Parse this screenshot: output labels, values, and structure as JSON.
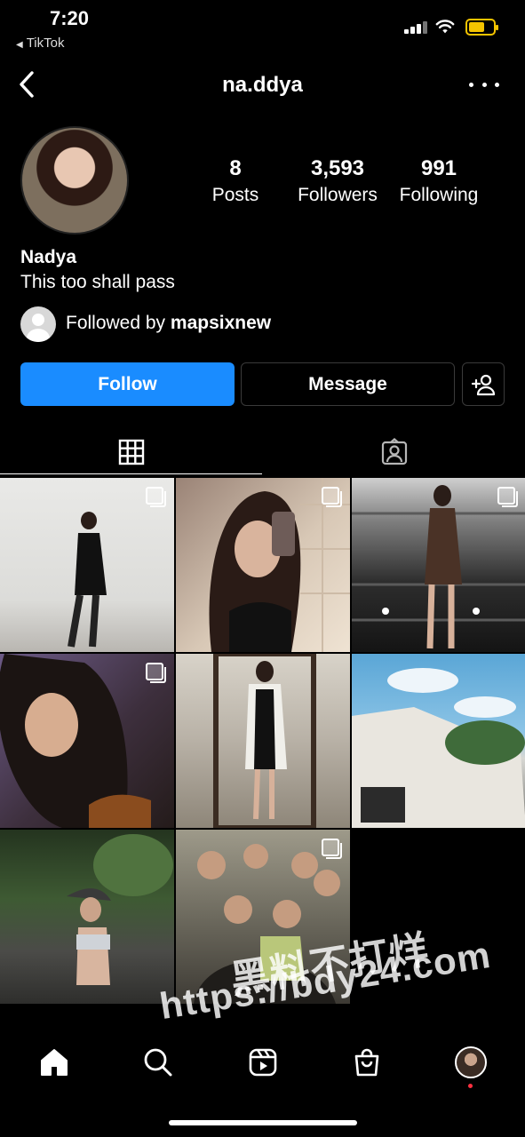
{
  "status_bar": {
    "time": "7:20",
    "back_app": "TikTok"
  },
  "header": {
    "username": "na.ddya"
  },
  "profile": {
    "stats": [
      {
        "value": "8",
        "label": "Posts"
      },
      {
        "value": "3,593",
        "label": "Followers"
      },
      {
        "value": "991",
        "label": "Following"
      }
    ],
    "display_name": "Nadya",
    "bio": "This too shall pass",
    "followed_by_prefix": "Followed by",
    "followed_by_user": "mapsixnew"
  },
  "actions": {
    "follow": "Follow",
    "message": "Message"
  },
  "posts": [
    {
      "multi": true
    },
    {
      "multi": true
    },
    {
      "multi": true
    },
    {
      "multi": true
    },
    {
      "multi": false
    },
    {
      "multi": false
    },
    {
      "multi": false
    },
    {
      "multi": true
    }
  ],
  "watermark": {
    "line1": "黑料不打烊",
    "line2": "https://bdy24.com"
  },
  "colors": {
    "accent": "#1a8cff",
    "background": "#000000",
    "notification_dot": "#ff3040",
    "battery": "#f5c400"
  },
  "icons": {
    "back": "chevron-left-icon",
    "more": "more-icon",
    "add_person": "add-person-icon",
    "grid_tab": "grid-icon",
    "tagged_tab": "tagged-icon",
    "multiple_posts": "multiple-posts-icon",
    "nav": [
      "home-icon",
      "search-icon",
      "reels-icon",
      "shop-icon",
      "profile-icon"
    ]
  }
}
